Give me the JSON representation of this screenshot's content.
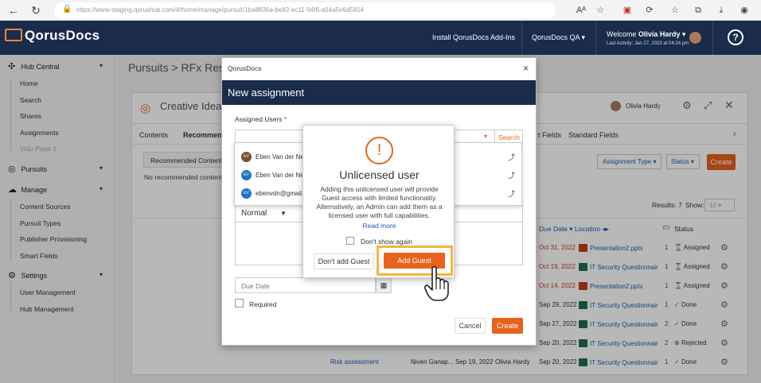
{
  "browser": {
    "url": "https://www-staging.qorushub.com/#/home/manage/pursuit/1ba8836a-be82-ec11-94f6-a04a5e6d5804",
    "back": "←",
    "refresh": "↻",
    "lock": "🔒",
    "icons": [
      "Aᴬ",
      "☆",
      "▣",
      "⟳",
      "☆",
      "⧉",
      "⤓",
      "◉"
    ]
  },
  "topnav": {
    "brand": "QorusDocs",
    "install": "Install QorusDocs Add-Ins",
    "workspace": "QorusDocs QA",
    "welcome": "Welcome",
    "user": "Olivia Hardy",
    "last_activity": "Last Activity: Jan 27, 2023 at 04:24 pm",
    "help": "?"
  },
  "sidebar": {
    "groups": [
      {
        "label": "Hub Central",
        "icon": "✣",
        "items": [
          "Home",
          "Search",
          "Shares",
          "Assignments",
          "Vidu Page 1"
        ]
      },
      {
        "label": "Pursuits",
        "icon": "◎",
        "items": []
      },
      {
        "label": "Manage",
        "icon": "☁",
        "items": [
          "Content Sources",
          "Pursuit Types",
          "Publisher Provisioning",
          "Smart Fields"
        ]
      },
      {
        "label": "Settings",
        "icon": "⚙",
        "items": [
          "User Management",
          "Hub Management"
        ]
      }
    ]
  },
  "page": {
    "breadcrumb": "Pursuits > RFx Respon",
    "pursuit_title": "Creative Idea",
    "owner": "Olivia Hardy",
    "tabs": [
      "Contents",
      "Recommende",
      "t Fields",
      "Standard Fields"
    ],
    "subtab": "Recommended Content",
    "no_content": "No recommended content f",
    "filter_type": "Assignment Type",
    "filter_status": "Status",
    "create": "Create",
    "results": "Results: 7",
    "show": "Show:",
    "show_value": "10",
    "columns": {
      "due": "Due Date",
      "location": "Location",
      "status": "Status"
    },
    "rows": [
      {
        "due": "Oct 31, 2022",
        "overdue": true,
        "file": "Presentation2.pptx",
        "kind": "ppt",
        "count": "1",
        "status": "Assigned"
      },
      {
        "due": "Oct 19, 2022",
        "overdue": true,
        "file": "IT Security Questionnair",
        "kind": "xls",
        "count": "1",
        "status": "Assigned"
      },
      {
        "due": "Oct 14, 2022",
        "overdue": true,
        "file": "Presentation2.pptx",
        "kind": "ppt",
        "count": "1",
        "status": "Assigned"
      },
      {
        "due": "Sep 29, 2022",
        "overdue": false,
        "file": "IT Security Questionnair",
        "kind": "xls",
        "count": "1",
        "status": "Done"
      },
      {
        "due": "Sep 27, 2022",
        "overdue": false,
        "file": "IT Security Questionnair",
        "kind": "xls",
        "count": "2",
        "status": "Done"
      },
      {
        "due": "Sep 20, 2022",
        "overdue": false,
        "file": "IT Security Questionnair",
        "kind": "xls",
        "count": "2",
        "status": "Rejected"
      },
      {
        "due": "Sep 20, 2022",
        "overdue": false,
        "file": "IT Security Questionnair",
        "kind": "xls",
        "count": "1",
        "status": "Done"
      }
    ],
    "last_row": {
      "name": "Risk assessment",
      "assignee": "Niven Ganap...",
      "date": "Sep 19, 2022",
      "user": "Olivia Hardy"
    }
  },
  "dialog": {
    "window_title": "QorusDocs",
    "title": "New assignment",
    "assigned_users_label": "Assigned Users",
    "required_mark": "*",
    "search": "Search",
    "format": "Normal",
    "due_date_placeholder": "Due Date",
    "required_label": "Required",
    "cancel": "Cancel",
    "create": "Create"
  },
  "dropdown": [
    {
      "name": "Eben Van der Nes",
      "initials": "EV"
    },
    {
      "name": "Eben Van der Nes",
      "initials": "EV"
    },
    {
      "name": "ebenvdn@gmail.c",
      "initials": "EV"
    }
  ],
  "popup": {
    "icon": "!",
    "title": "Unlicensed user",
    "body": "Adding this unlicensed user will provide Guest access with limited functionality. Alternatively, an Admin can add them as a licensed user with full capabilities.",
    "read_more": "Read more",
    "dont_show": "Don't show again",
    "no_button": "Don't add Guest",
    "add_button": "Add Guest"
  },
  "colors": {
    "navy": "#1a2b4c",
    "orange": "#e8621d",
    "highlight": "#f4b63f"
  }
}
